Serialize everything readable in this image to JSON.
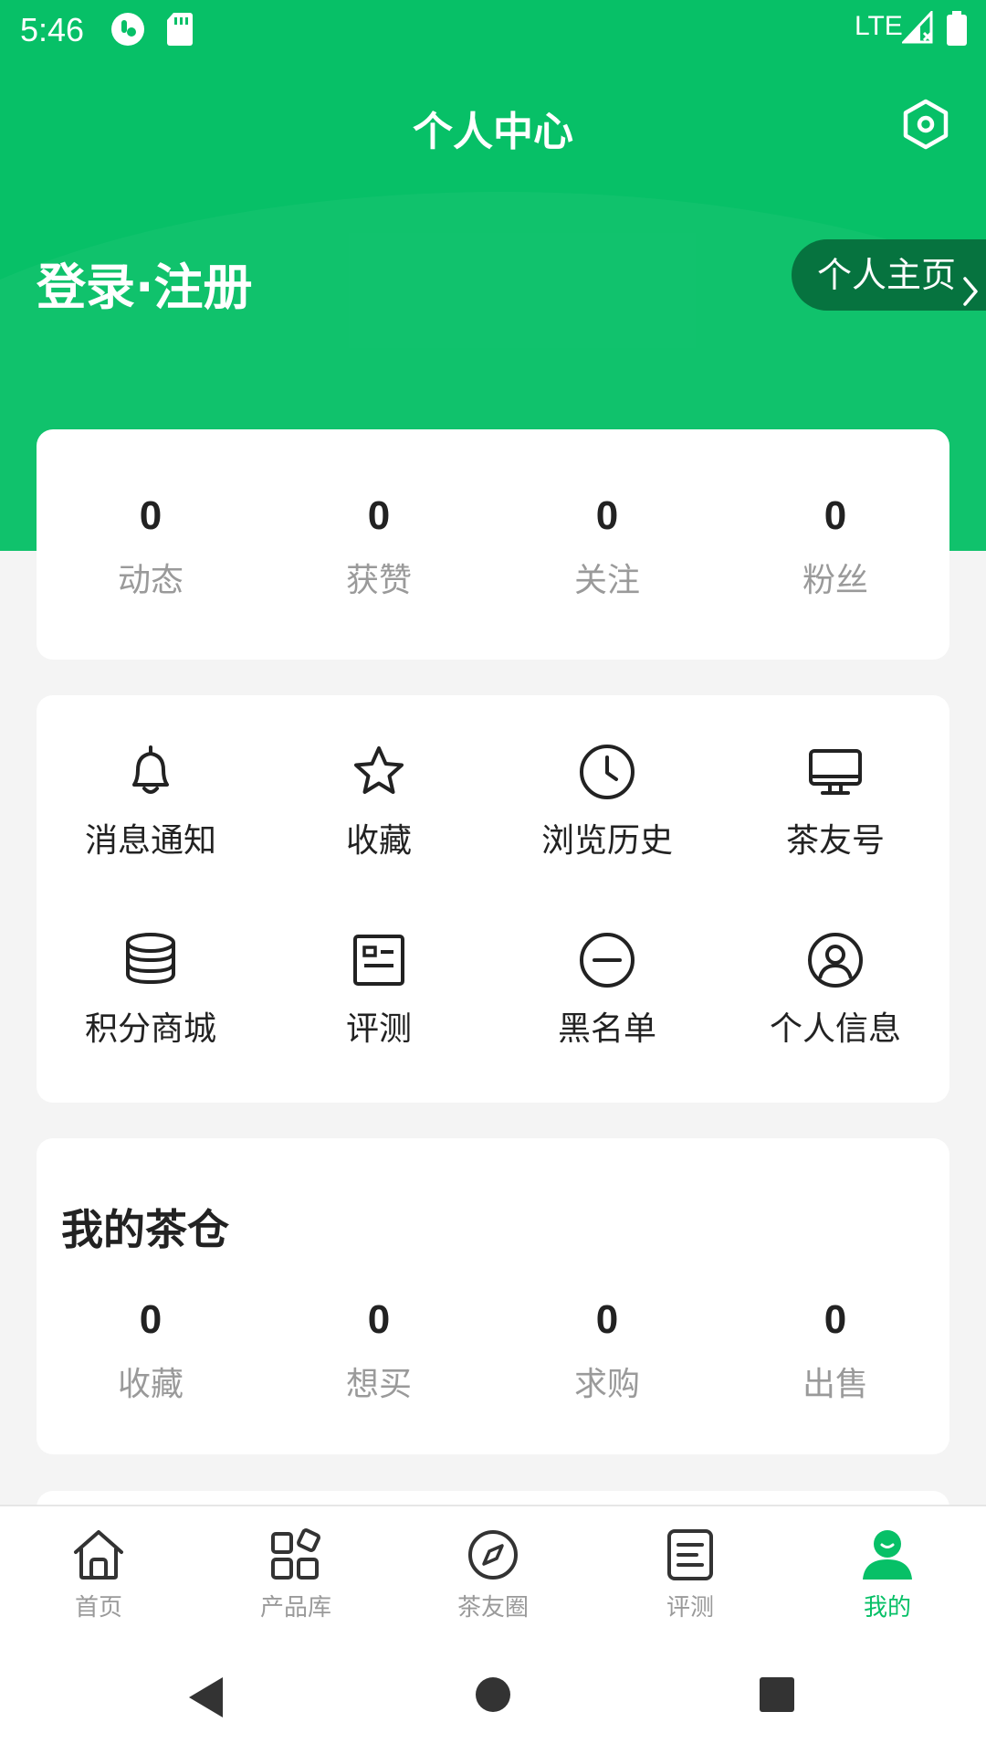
{
  "status_bar": {
    "time": "5:46",
    "network": "LTE"
  },
  "header": {
    "title": "个人中心"
  },
  "profile": {
    "login_text": "登录·注册",
    "home_button": "个人主页"
  },
  "stats": [
    {
      "value": "0",
      "label": "动态"
    },
    {
      "value": "0",
      "label": "获赞"
    },
    {
      "value": "0",
      "label": "关注"
    },
    {
      "value": "0",
      "label": "粉丝"
    }
  ],
  "menu": [
    {
      "label": "消息通知",
      "icon": "bell-icon"
    },
    {
      "label": "收藏",
      "icon": "star-icon"
    },
    {
      "label": "浏览历史",
      "icon": "clock-icon"
    },
    {
      "label": "茶友号",
      "icon": "monitor-icon"
    },
    {
      "label": "积分商城",
      "icon": "coins-icon"
    },
    {
      "label": "评测",
      "icon": "id-card-icon"
    },
    {
      "label": "黑名单",
      "icon": "minus-circle-icon"
    },
    {
      "label": "个人信息",
      "icon": "user-circle-icon"
    }
  ],
  "warehouse": {
    "title": "我的茶仓",
    "stats": [
      {
        "value": "0",
        "label": "收藏"
      },
      {
        "value": "0",
        "label": "想买"
      },
      {
        "value": "0",
        "label": "求购"
      },
      {
        "value": "0",
        "label": "出售"
      }
    ]
  },
  "bottom_nav": [
    {
      "label": "首页",
      "icon": "home-icon",
      "active": false
    },
    {
      "label": "产品库",
      "icon": "grid-icon",
      "active": false
    },
    {
      "label": "茶友圈",
      "icon": "compass-icon",
      "active": false
    },
    {
      "label": "评测",
      "icon": "document-icon",
      "active": false
    },
    {
      "label": "我的",
      "icon": "person-icon",
      "active": true
    }
  ],
  "colors": {
    "brand": "#07c067",
    "brand_dark": "#06733f",
    "muted": "#9a9a9a"
  }
}
